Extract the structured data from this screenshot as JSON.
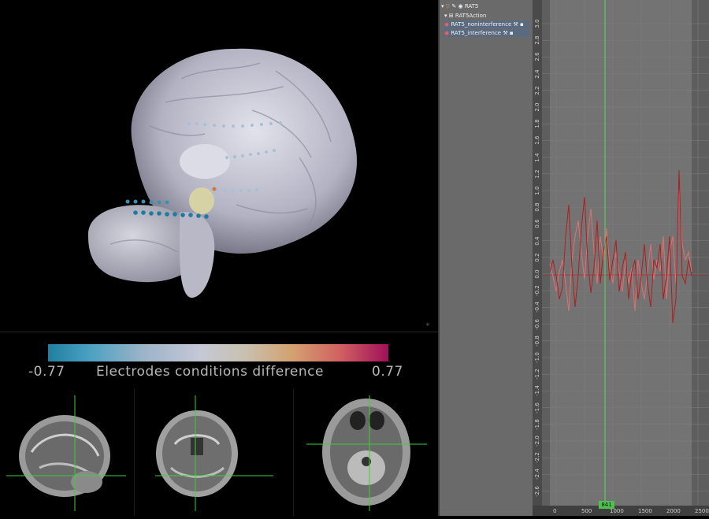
{
  "colorbar": {
    "min_label": "-0.77",
    "title": "Electrodes conditions difference",
    "max_label": "0.77"
  },
  "outliner": {
    "root": "RAT5",
    "action": "RAT5Action",
    "channels": [
      "RAT5_noninterference",
      "RAT5_interference"
    ]
  },
  "graph": {
    "current_frame": "841",
    "x_ticks": [
      "0",
      "500",
      "1000",
      "1500",
      "2000",
      "2500"
    ],
    "y_ticks": [
      "3.0",
      "2.8",
      "2.6",
      "2.4",
      "2.2",
      "2.0",
      "1.8",
      "1.6",
      "1.4",
      "1.2",
      "1.0",
      "0.8",
      "0.6",
      "0.4",
      "0.2",
      "0.0",
      "-0.2",
      "-0.4",
      "-0.6",
      "-0.8",
      "-1.0",
      "-1.2",
      "-1.4",
      "-1.6",
      "-1.8",
      "-2.0",
      "-2.2",
      "-2.4",
      "-2.6"
    ]
  },
  "colors": {
    "cursor": "#5fd35f",
    "curve_dark": "#b01e1e",
    "curve_light": "#e06a6a"
  },
  "icons": [
    "eye-icon",
    "wrench-icon",
    "lock-icon",
    "cursor-icon",
    "action-icon"
  ]
}
